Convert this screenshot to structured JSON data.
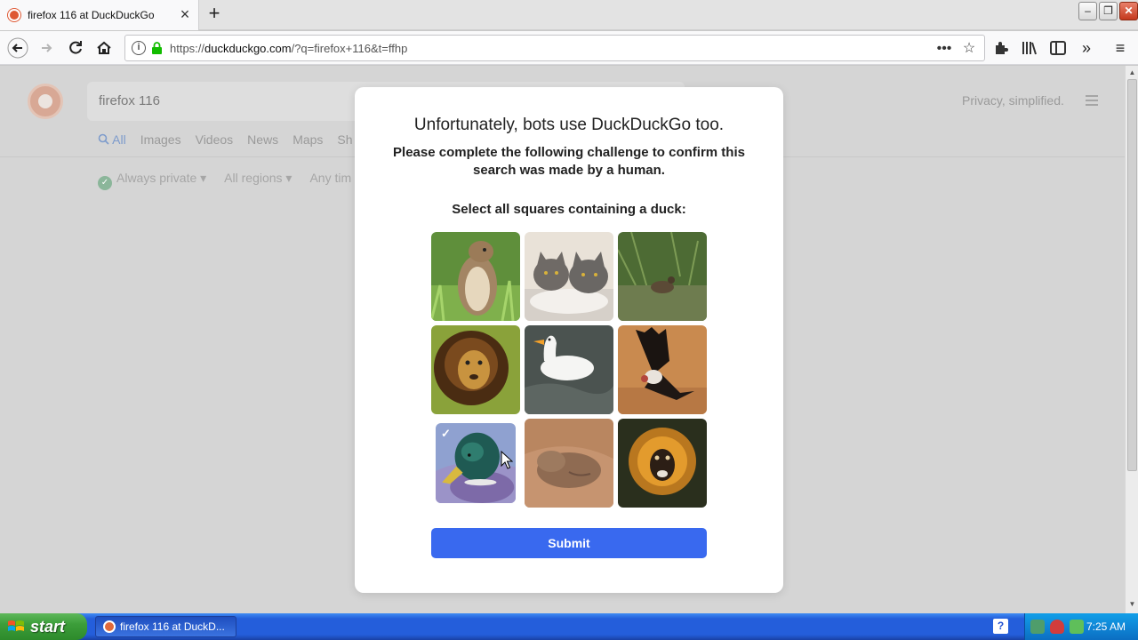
{
  "browser": {
    "tab_title": "firefox 116 at DuckDuckGo",
    "url_prefix": "https://",
    "url_domain": "duckduckgo.com",
    "url_rest": "/?q=firefox+116&t=ffhp"
  },
  "page": {
    "search_query": "firefox 116",
    "header_right": "Privacy, simplified.",
    "tabs": [
      "All",
      "Images",
      "Videos",
      "News",
      "Maps",
      "Sh"
    ],
    "filters": [
      "Always private ▾",
      "All regions ▾",
      "Any tim"
    ]
  },
  "challenge": {
    "title": "Unfortunately, bots use DuckDuckGo too.",
    "subtitle": "Please complete the following challenge to confirm this search was made by a human.",
    "prompt": "Select all squares containing a duck:",
    "submit_label": "Submit",
    "tiles": [
      {
        "subject": "squirrel",
        "selected": false
      },
      {
        "subject": "cats",
        "selected": false
      },
      {
        "subject": "bird-in-grass",
        "selected": false
      },
      {
        "subject": "lion",
        "selected": false
      },
      {
        "subject": "white-duck",
        "selected": false
      },
      {
        "subject": "condor",
        "selected": false
      },
      {
        "subject": "mallard-duck",
        "selected": true
      },
      {
        "subject": "sleeping-animal",
        "selected": false
      },
      {
        "subject": "monkey",
        "selected": false
      }
    ]
  },
  "taskbar": {
    "start_label": "start",
    "task_label": "firefox 116 at DuckD...",
    "clock": "7:25 AM"
  }
}
